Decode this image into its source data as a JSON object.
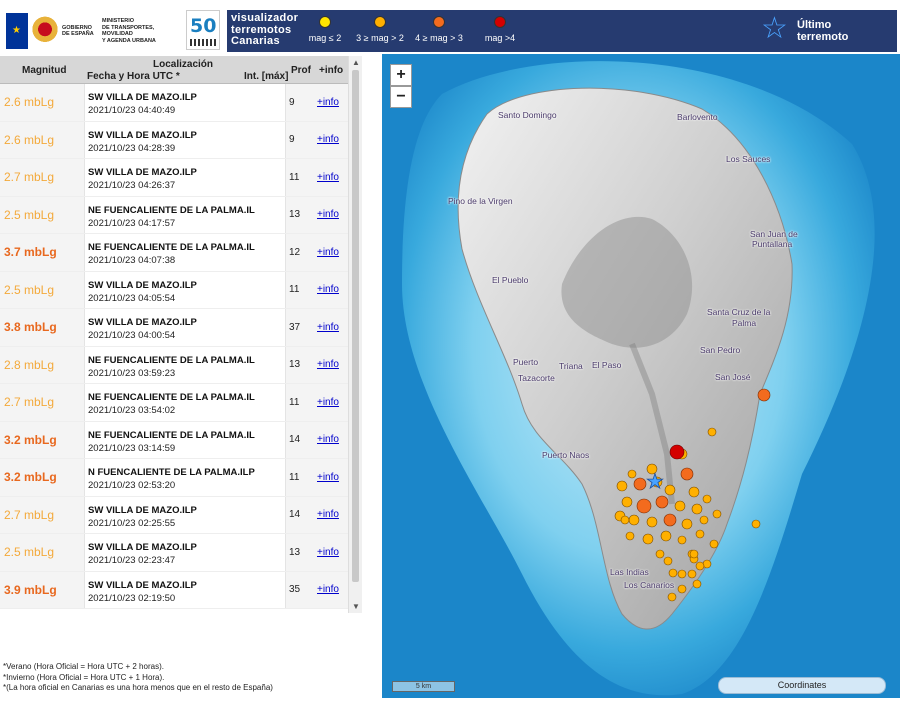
{
  "header": {
    "gov_col1": [
      "GOBIERNO",
      "DE ESPAÑA"
    ],
    "gov_col2": [
      "MINISTERIO",
      "DE TRANSPORTES, MOVILIDAD",
      "Y AGENDA URBANA"
    ],
    "ign_years": "50",
    "legend_title": [
      "visualizador",
      "terremotos",
      "Canarias"
    ],
    "legend_items": [
      {
        "label": "mag ≤ 2",
        "color": "#ffe600"
      },
      {
        "label": "3 ≥ mag > 2",
        "color": "#ffb000"
      },
      {
        "label": "4 ≥ mag > 3",
        "color": "#f36b1e"
      },
      {
        "label": "mag >4",
        "color": "#d40000"
      }
    ],
    "last_label": [
      "Último",
      "terremoto"
    ]
  },
  "table": {
    "headers": {
      "magnitude": "Magnitud",
      "location": "Localización",
      "date": "Fecha y Hora UTC *",
      "intensity": "Int. [máx]",
      "depth": "Prof",
      "info": "+info"
    },
    "rows": [
      {
        "mag": "2.6 mbLg",
        "color": "#f3a93a",
        "bold": false,
        "loc": "SW VILLA DE MAZO.ILP",
        "date": "2021/10/23 04:40:49",
        "prof": "9",
        "info": "+info"
      },
      {
        "mag": "2.6 mbLg",
        "color": "#f3a93a",
        "bold": false,
        "loc": "SW VILLA DE MAZO.ILP",
        "date": "2021/10/23 04:28:39",
        "prof": "9",
        "info": "+info"
      },
      {
        "mag": "2.7 mbLg",
        "color": "#f3a93a",
        "bold": false,
        "loc": "SW VILLA DE MAZO.ILP",
        "date": "2021/10/23 04:26:37",
        "prof": "11",
        "info": "+info"
      },
      {
        "mag": "2.5 mbLg",
        "color": "#f3a93a",
        "bold": false,
        "loc": "NE FUENCALIENTE DE LA PALMA.IL",
        "date": "2021/10/23 04:17:57",
        "prof": "13",
        "info": "+info"
      },
      {
        "mag": "3.7 mbLg",
        "color": "#e8681e",
        "bold": true,
        "loc": "NE FUENCALIENTE DE LA PALMA.IL",
        "date": "2021/10/23 04:07:38",
        "prof": "12",
        "info": "+info"
      },
      {
        "mag": "2.5 mbLg",
        "color": "#f3a93a",
        "bold": false,
        "loc": "SW VILLA DE MAZO.ILP",
        "date": "2021/10/23 04:05:54",
        "prof": "11",
        "info": "+info"
      },
      {
        "mag": "3.8 mbLg",
        "color": "#e8681e",
        "bold": true,
        "loc": "SW VILLA DE MAZO.ILP",
        "date": "2021/10/23 04:00:54",
        "prof": "37",
        "info": "+info"
      },
      {
        "mag": "2.8 mbLg",
        "color": "#f3a93a",
        "bold": false,
        "loc": "NE FUENCALIENTE DE LA PALMA.IL",
        "date": "2021/10/23 03:59:23",
        "prof": "13",
        "info": "+info"
      },
      {
        "mag": "2.7 mbLg",
        "color": "#f3a93a",
        "bold": false,
        "loc": "NE FUENCALIENTE DE LA PALMA.IL",
        "date": "2021/10/23 03:54:02",
        "prof": "11",
        "info": "+info"
      },
      {
        "mag": "3.2 mbLg",
        "color": "#e8681e",
        "bold": true,
        "loc": "NE FUENCALIENTE DE LA PALMA.IL",
        "date": "2021/10/23 03:14:59",
        "prof": "14",
        "info": "+info"
      },
      {
        "mag": "3.2 mbLg",
        "color": "#e8681e",
        "bold": true,
        "loc": "N FUENCALIENTE DE LA PALMA.ILP",
        "date": "2021/10/23 02:53:20",
        "prof": "11",
        "info": "+info"
      },
      {
        "mag": "2.7 mbLg",
        "color": "#f3a93a",
        "bold": false,
        "loc": "SW VILLA DE MAZO.ILP",
        "date": "2021/10/23 02:25:55",
        "prof": "14",
        "info": "+info"
      },
      {
        "mag": "2.5 mbLg",
        "color": "#f3a93a",
        "bold": false,
        "loc": "SW VILLA DE MAZO.ILP",
        "date": "2021/10/23 02:23:47",
        "prof": "13",
        "info": "+info"
      },
      {
        "mag": "3.9 mbLg",
        "color": "#e8681e",
        "bold": true,
        "loc": "SW VILLA DE MAZO.ILP",
        "date": "2021/10/23 02:19:50",
        "prof": "35",
        "info": "+info"
      }
    ]
  },
  "footnotes": [
    "*Verano (Hora Oficial = Hora UTC + 2 horas).",
    "*Invierno (Hora Oficial = Hora UTC + 1 Hora).",
    "*(La hora oficial en Canarias es una hora menos que en el resto de España)"
  ],
  "map": {
    "zoom_in": "+",
    "zoom_out": "−",
    "scale_label": "5 km",
    "coordinates_label": "Coordinates",
    "places": [
      "Santo Domingo",
      "Barlovento",
      "Los Sauces",
      "Pino de la Virgen",
      "San Juan de",
      "Puntallana",
      "El Pueblo",
      "Santa Cruz de la",
      "Palma",
      "San Pedro",
      "Puerto",
      "Tazacorte",
      "Triana",
      "El Paso",
      "San José",
      "Puerto Naos",
      "Las Indias",
      "Los Canarios"
    ]
  }
}
